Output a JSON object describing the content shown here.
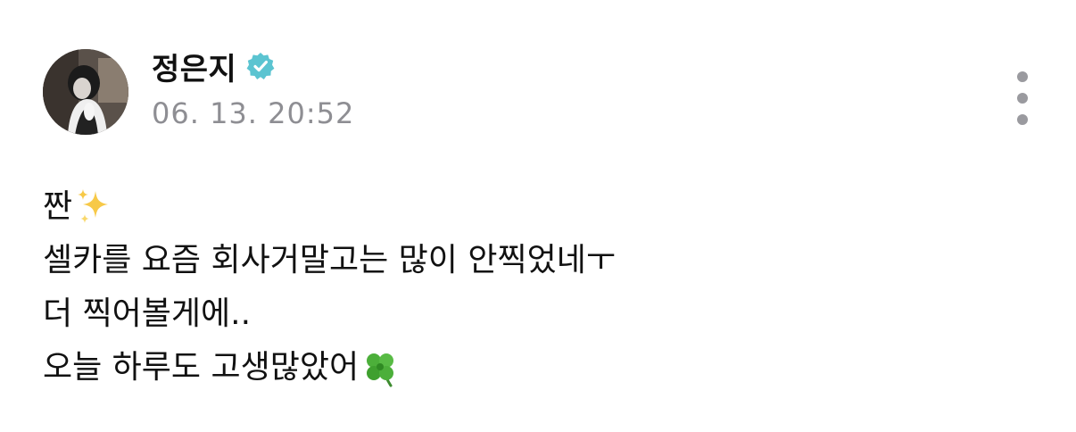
{
  "author": {
    "name": "정은지",
    "verified": true
  },
  "post": {
    "timestamp": "06. 13. 20:52",
    "lines": [
      "짠",
      "셀카를 요즘 회사거말고는 많이 안찍었네ㅜ",
      "더 찍어볼게에..",
      "오늘 하루도 고생많았어"
    ],
    "line_emojis": [
      "sparkles-icon",
      "",
      "",
      "four-leaf-clover-icon"
    ]
  },
  "icons": {
    "verified": "verified-badge-icon",
    "more": "more-vertical-icon"
  },
  "colors": {
    "verified_badge": "#5bc4d1",
    "timestamp": "#8e8e93",
    "more_dots": "#9a9a9f",
    "text": "#111111"
  }
}
